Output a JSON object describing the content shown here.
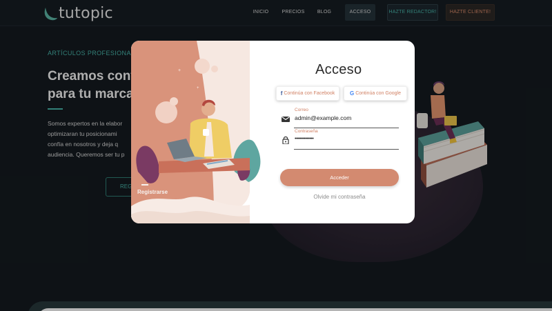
{
  "header": {
    "logo_text": "tutopic",
    "nav": {
      "inicio": "INICIO",
      "precios": "PRECIOS",
      "blog": "BLOG",
      "acceso": "ACCESO",
      "redactor": "HAZTE REDACTOR!",
      "cliente": "HAZTE CLIENTE!"
    }
  },
  "hero": {
    "kicker": "ARTÍCULOS PROFESIONAL",
    "headline_1": "Creamos conte",
    "headline_2": "para tu marca",
    "description": "Somos expertos en la elabor\noptimizaran tu posicionami\nconfía en nosotros y deja q\naudiencia. Queremos ser tu p",
    "button_label": "REG"
  },
  "modal": {
    "register_link": "Registrarse",
    "title": "Acceso",
    "facebook_label": "Continúa con Facebook",
    "facebook_glyph": "f",
    "google_label": "Continúa con Google",
    "google_glyph": "G",
    "email_label": "Correo",
    "email_value": "admin@example.com",
    "password_label": "Contraseña",
    "password_value": "••••••••••••••",
    "submit_label": "Acceder",
    "forgot_label": "Olvide mi contraseña"
  },
  "colors": {
    "accent_teal": "#47b3a8",
    "accent_salmon": "#d38a70",
    "background": "#141a1f"
  }
}
